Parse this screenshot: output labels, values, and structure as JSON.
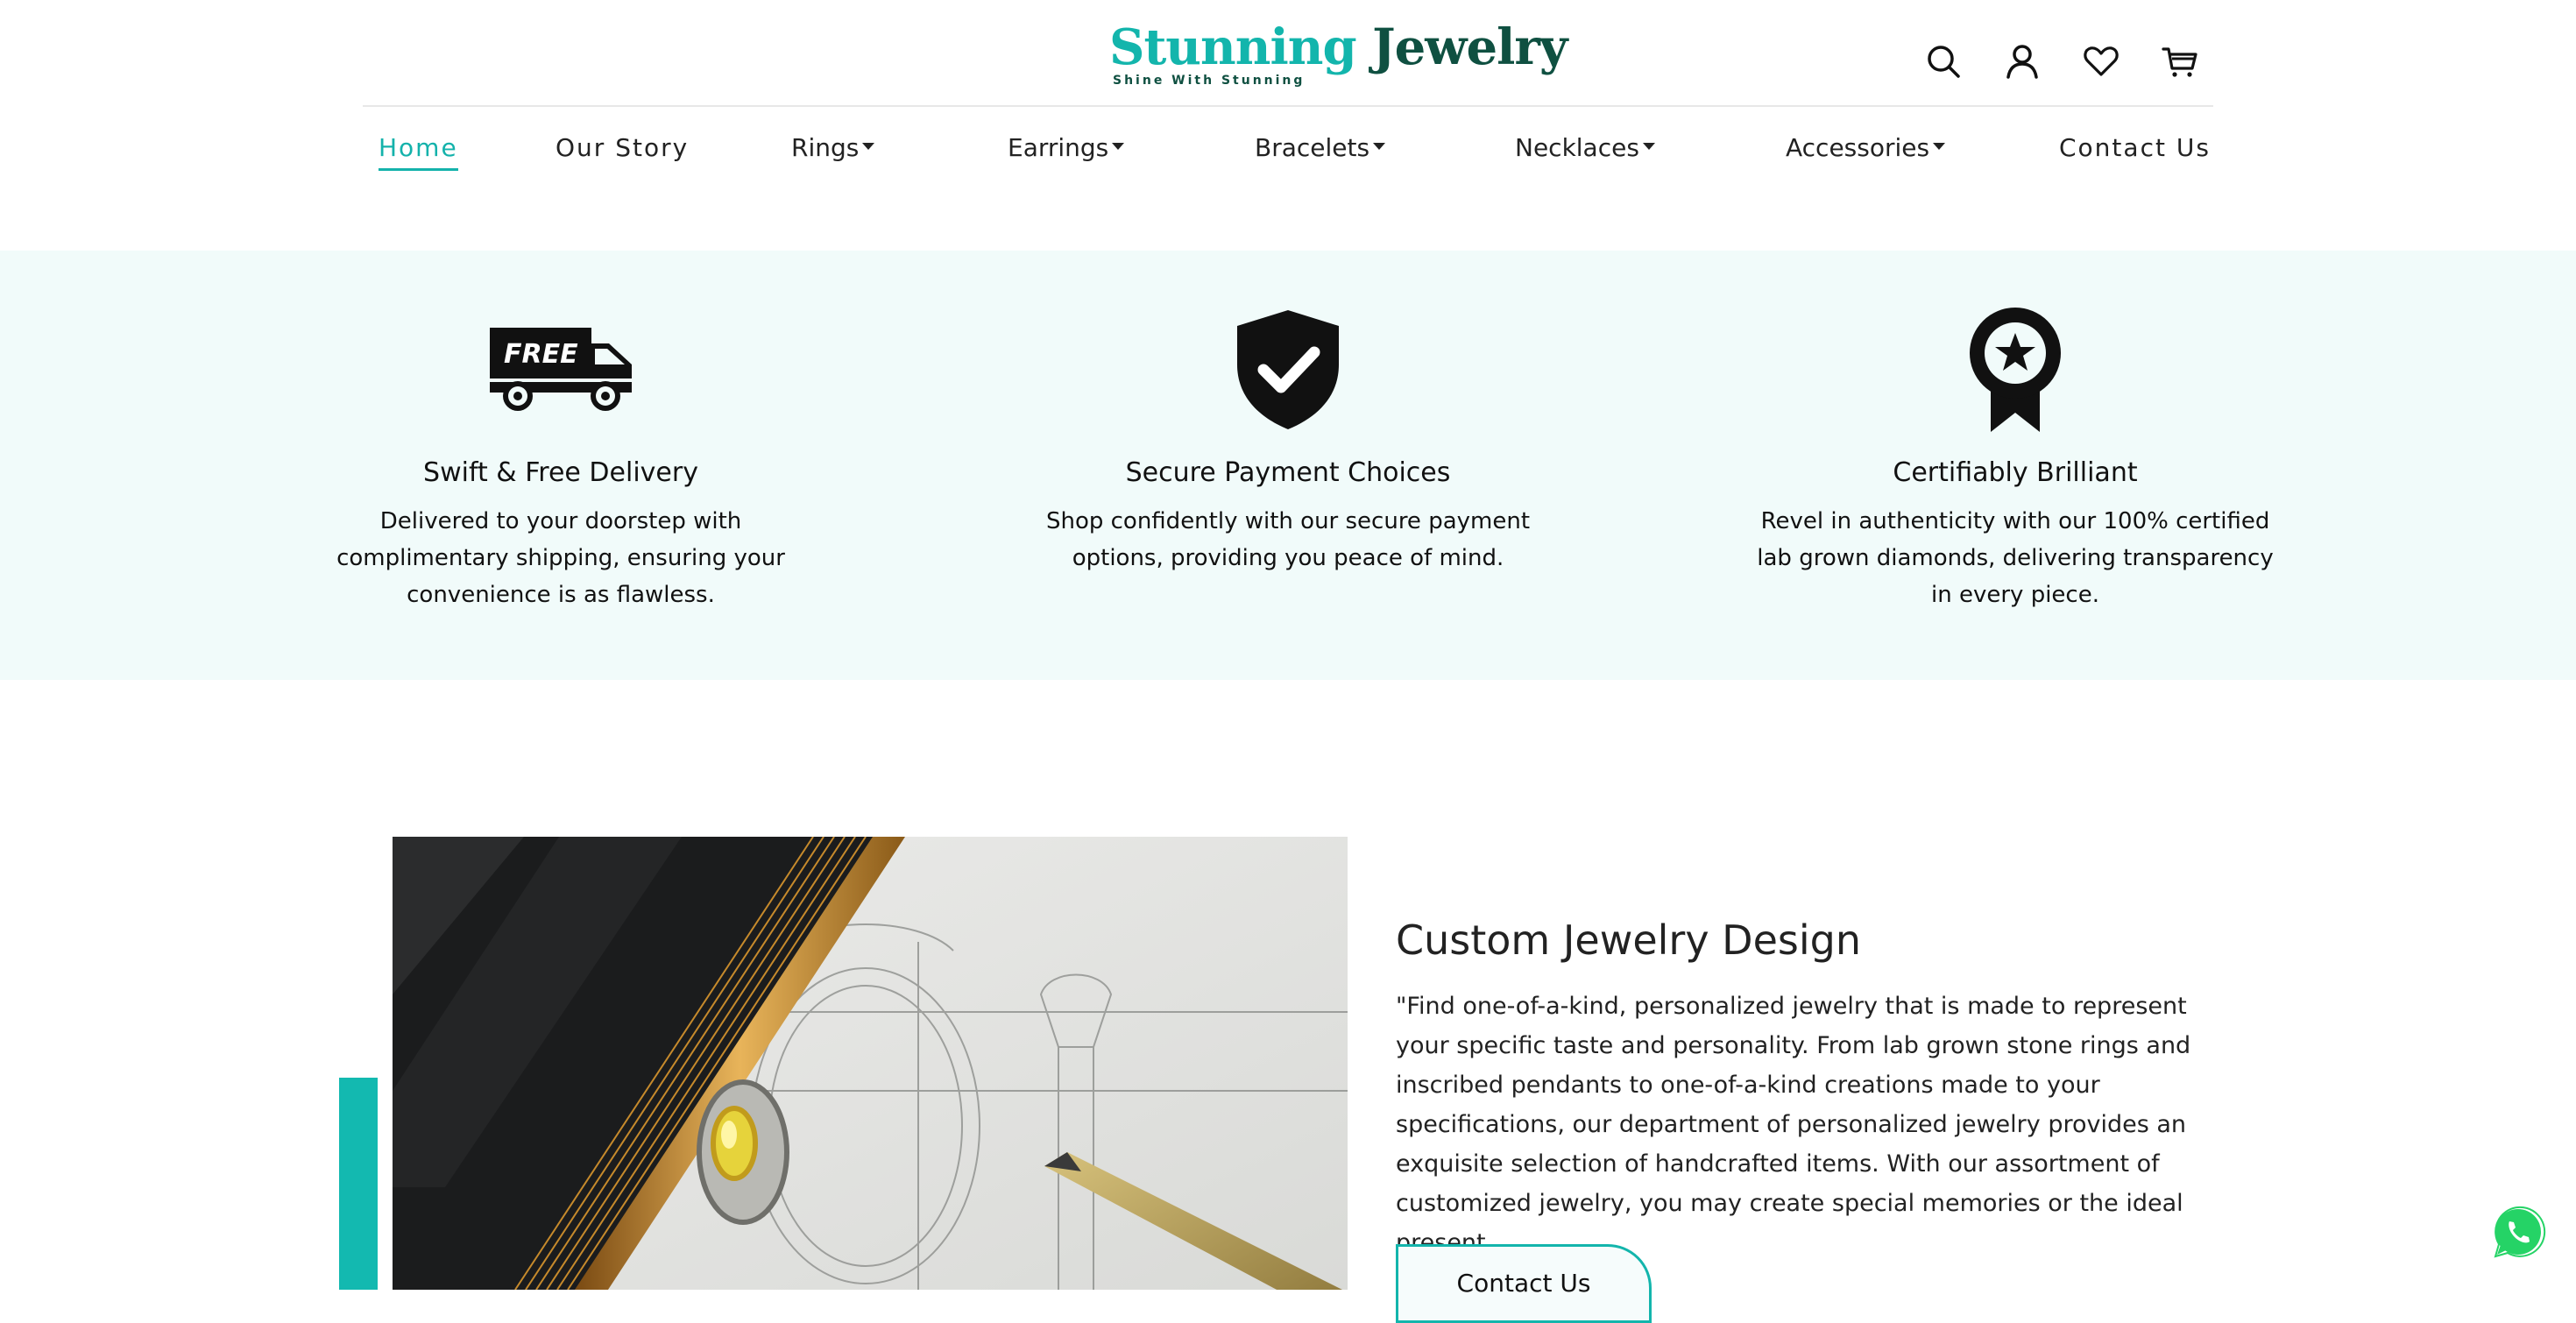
{
  "brand": {
    "name_part1": "Stunning",
    "name_part2": "Jewelry",
    "tagline": "Shine With Stunning"
  },
  "header_icons": [
    "search-icon",
    "user-icon",
    "heart-icon",
    "cart-icon"
  ],
  "nav": {
    "items": [
      {
        "label": "Home",
        "active": true,
        "dropdown": false
      },
      {
        "label": "Our Story",
        "active": false,
        "dropdown": false
      },
      {
        "label": "Rings",
        "active": false,
        "dropdown": true
      },
      {
        "label": "Earrings",
        "active": false,
        "dropdown": true
      },
      {
        "label": "Bracelets",
        "active": false,
        "dropdown": true
      },
      {
        "label": "Necklaces",
        "active": false,
        "dropdown": true
      },
      {
        "label": "Accessories",
        "active": false,
        "dropdown": true
      },
      {
        "label": "Contact Us",
        "active": false,
        "dropdown": false
      }
    ]
  },
  "features": [
    {
      "icon": "free-delivery-truck-icon",
      "icon_text": "FREE",
      "title": "Swift & Free Delivery",
      "text": "Delivered to your doorstep with complimentary shipping, ensuring your convenience is as flawless."
    },
    {
      "icon": "shield-check-icon",
      "title": "Secure Payment Choices",
      "text": "Shop confidently with our secure payment options, providing you peace of mind."
    },
    {
      "icon": "award-ribbon-icon",
      "title": "Certifiably Brilliant",
      "text": "Revel in authenticity with our 100% certified lab grown diamonds, delivering transparency in every piece."
    }
  ],
  "custom_design": {
    "title": "Custom Jewelry Design",
    "text": "\"Find one-of-a-kind, personalized jewelry that is made to represent your specific taste and personality. From lab grown stone rings and inscribed pendants to one-of-a-kind creations made to your specifications, our department of personalized jewelry provides an exquisite selection of handcrafted items. With our assortment of customized jewelry, you may create special memories or the ideal present.",
    "button_label": "Contact Us",
    "image": "ring-sketch-with-pencil-image"
  },
  "colors": {
    "accent": "#13b5ac",
    "brand_dark": "#0f5041",
    "features_bg": "#f1fbfa",
    "whatsapp": "#25d366"
  }
}
